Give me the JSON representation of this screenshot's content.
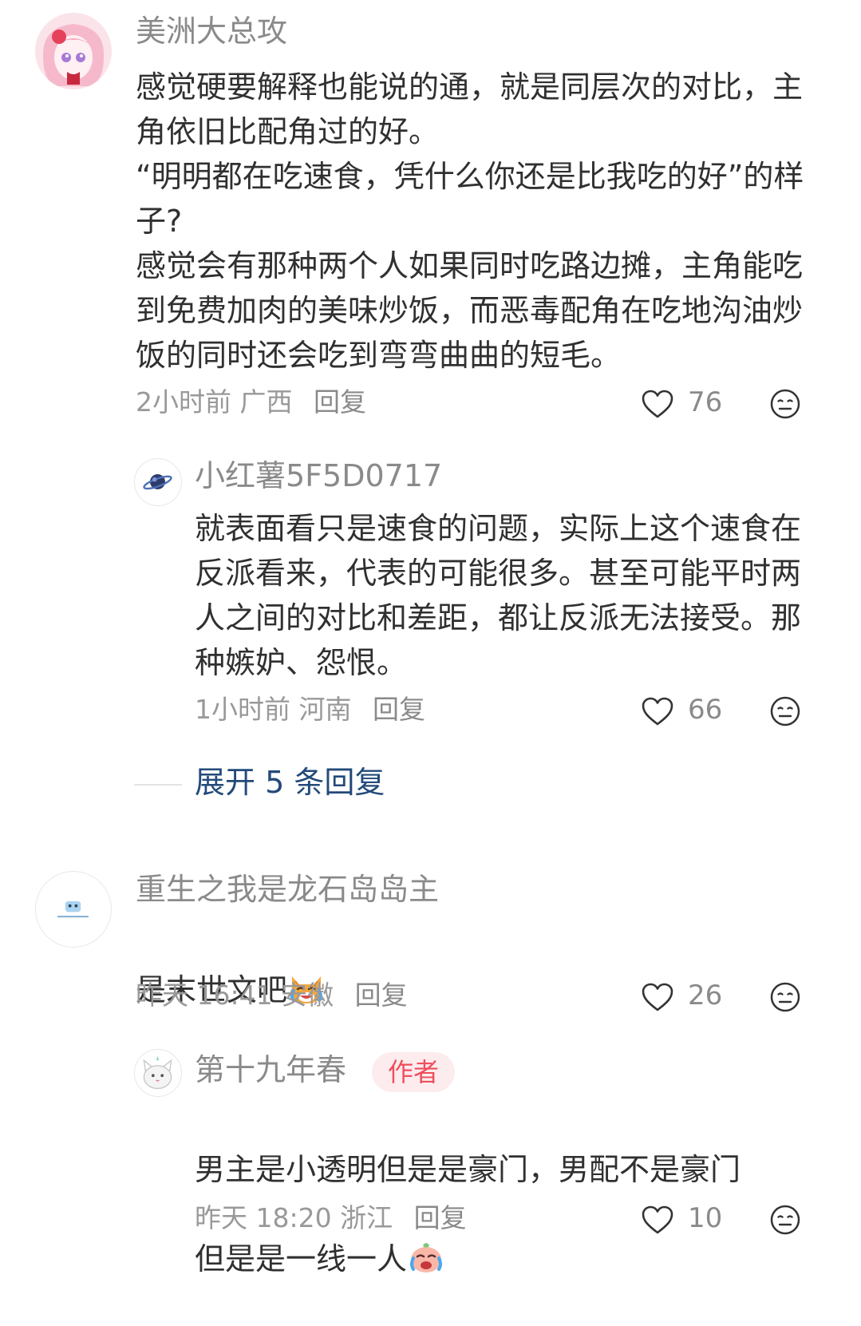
{
  "comments": [
    {
      "username": "美洲大总攻",
      "text": "感觉硬要解释也能说的通，就是同层次的对比，主角依旧比配角过的好。\n“明明都在吃速食，凭什么你还是比我吃的好”的样子?\n感觉会有那种两个人如果同时吃路边摊，主角能吃到免费加肉的美味炒饭，而恶毒配角在吃地沟油炒饭的同时还会吃到弯弯曲曲的短毛。",
      "time": "2小时前",
      "location": "广西",
      "reply_label": "回复",
      "likes": "76",
      "replies": [
        {
          "username": "小红薯5F5D0717",
          "text": "就表面看只是速食的问题，实际上这个速食在反派看来，代表的可能很多。甚至可能平时两人之间的对比和差距，都让反派无法接受。那种嫉妒、怨恨。",
          "time": "1小时前",
          "location": "河南",
          "reply_label": "回复",
          "likes": "66"
        }
      ],
      "expand_label": "展开 5 条回复"
    },
    {
      "username": "重生之我是龙石岛岛主",
      "text": "是末世文吧",
      "time": "昨天 16:41",
      "location": "安徽",
      "reply_label": "回复",
      "likes": "26",
      "replies": [
        {
          "username": "第十九年春",
          "badge": "作者",
          "text_line1": "男主是小透明但是是豪门，男配不是豪门",
          "text_line2": "但是是一线一人",
          "time": "昨天 18:20",
          "location": "浙江",
          "reply_label": "回复",
          "likes": "10"
        }
      ]
    }
  ],
  "colors": {
    "username": "#8a8a8a",
    "body_text": "#303030",
    "meta": "#999999",
    "expand_link": "#234a7a",
    "author_badge_bg": "#fdecee",
    "author_badge_text": "#ef4e5d"
  },
  "icons": {
    "like": "heart-outline-icon",
    "emoji": "neutral-face-icon"
  }
}
